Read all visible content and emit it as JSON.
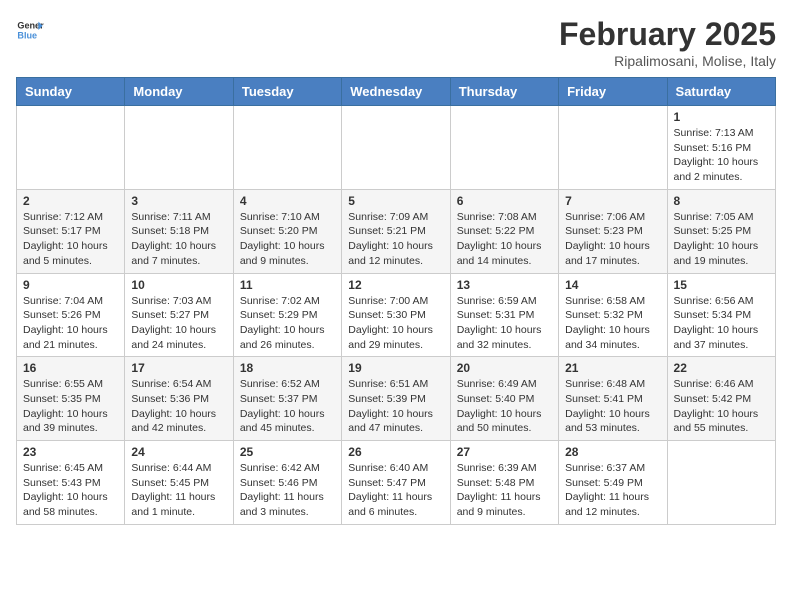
{
  "header": {
    "logo_line1": "General",
    "logo_line2": "Blue",
    "title": "February 2025",
    "subtitle": "Ripalimosani, Molise, Italy"
  },
  "days_of_week": [
    "Sunday",
    "Monday",
    "Tuesday",
    "Wednesday",
    "Thursday",
    "Friday",
    "Saturday"
  ],
  "weeks": [
    [
      {
        "day": "",
        "info": ""
      },
      {
        "day": "",
        "info": ""
      },
      {
        "day": "",
        "info": ""
      },
      {
        "day": "",
        "info": ""
      },
      {
        "day": "",
        "info": ""
      },
      {
        "day": "",
        "info": ""
      },
      {
        "day": "1",
        "info": "Sunrise: 7:13 AM\nSunset: 5:16 PM\nDaylight: 10 hours and 2 minutes."
      }
    ],
    [
      {
        "day": "2",
        "info": "Sunrise: 7:12 AM\nSunset: 5:17 PM\nDaylight: 10 hours and 5 minutes."
      },
      {
        "day": "3",
        "info": "Sunrise: 7:11 AM\nSunset: 5:18 PM\nDaylight: 10 hours and 7 minutes."
      },
      {
        "day": "4",
        "info": "Sunrise: 7:10 AM\nSunset: 5:20 PM\nDaylight: 10 hours and 9 minutes."
      },
      {
        "day": "5",
        "info": "Sunrise: 7:09 AM\nSunset: 5:21 PM\nDaylight: 10 hours and 12 minutes."
      },
      {
        "day": "6",
        "info": "Sunrise: 7:08 AM\nSunset: 5:22 PM\nDaylight: 10 hours and 14 minutes."
      },
      {
        "day": "7",
        "info": "Sunrise: 7:06 AM\nSunset: 5:23 PM\nDaylight: 10 hours and 17 minutes."
      },
      {
        "day": "8",
        "info": "Sunrise: 7:05 AM\nSunset: 5:25 PM\nDaylight: 10 hours and 19 minutes."
      }
    ],
    [
      {
        "day": "9",
        "info": "Sunrise: 7:04 AM\nSunset: 5:26 PM\nDaylight: 10 hours and 21 minutes."
      },
      {
        "day": "10",
        "info": "Sunrise: 7:03 AM\nSunset: 5:27 PM\nDaylight: 10 hours and 24 minutes."
      },
      {
        "day": "11",
        "info": "Sunrise: 7:02 AM\nSunset: 5:29 PM\nDaylight: 10 hours and 26 minutes."
      },
      {
        "day": "12",
        "info": "Sunrise: 7:00 AM\nSunset: 5:30 PM\nDaylight: 10 hours and 29 minutes."
      },
      {
        "day": "13",
        "info": "Sunrise: 6:59 AM\nSunset: 5:31 PM\nDaylight: 10 hours and 32 minutes."
      },
      {
        "day": "14",
        "info": "Sunrise: 6:58 AM\nSunset: 5:32 PM\nDaylight: 10 hours and 34 minutes."
      },
      {
        "day": "15",
        "info": "Sunrise: 6:56 AM\nSunset: 5:34 PM\nDaylight: 10 hours and 37 minutes."
      }
    ],
    [
      {
        "day": "16",
        "info": "Sunrise: 6:55 AM\nSunset: 5:35 PM\nDaylight: 10 hours and 39 minutes."
      },
      {
        "day": "17",
        "info": "Sunrise: 6:54 AM\nSunset: 5:36 PM\nDaylight: 10 hours and 42 minutes."
      },
      {
        "day": "18",
        "info": "Sunrise: 6:52 AM\nSunset: 5:37 PM\nDaylight: 10 hours and 45 minutes."
      },
      {
        "day": "19",
        "info": "Sunrise: 6:51 AM\nSunset: 5:39 PM\nDaylight: 10 hours and 47 minutes."
      },
      {
        "day": "20",
        "info": "Sunrise: 6:49 AM\nSunset: 5:40 PM\nDaylight: 10 hours and 50 minutes."
      },
      {
        "day": "21",
        "info": "Sunrise: 6:48 AM\nSunset: 5:41 PM\nDaylight: 10 hours and 53 minutes."
      },
      {
        "day": "22",
        "info": "Sunrise: 6:46 AM\nSunset: 5:42 PM\nDaylight: 10 hours and 55 minutes."
      }
    ],
    [
      {
        "day": "23",
        "info": "Sunrise: 6:45 AM\nSunset: 5:43 PM\nDaylight: 10 hours and 58 minutes."
      },
      {
        "day": "24",
        "info": "Sunrise: 6:44 AM\nSunset: 5:45 PM\nDaylight: 11 hours and 1 minute."
      },
      {
        "day": "25",
        "info": "Sunrise: 6:42 AM\nSunset: 5:46 PM\nDaylight: 11 hours and 3 minutes."
      },
      {
        "day": "26",
        "info": "Sunrise: 6:40 AM\nSunset: 5:47 PM\nDaylight: 11 hours and 6 minutes."
      },
      {
        "day": "27",
        "info": "Sunrise: 6:39 AM\nSunset: 5:48 PM\nDaylight: 11 hours and 9 minutes."
      },
      {
        "day": "28",
        "info": "Sunrise: 6:37 AM\nSunset: 5:49 PM\nDaylight: 11 hours and 12 minutes."
      },
      {
        "day": "",
        "info": ""
      }
    ]
  ]
}
